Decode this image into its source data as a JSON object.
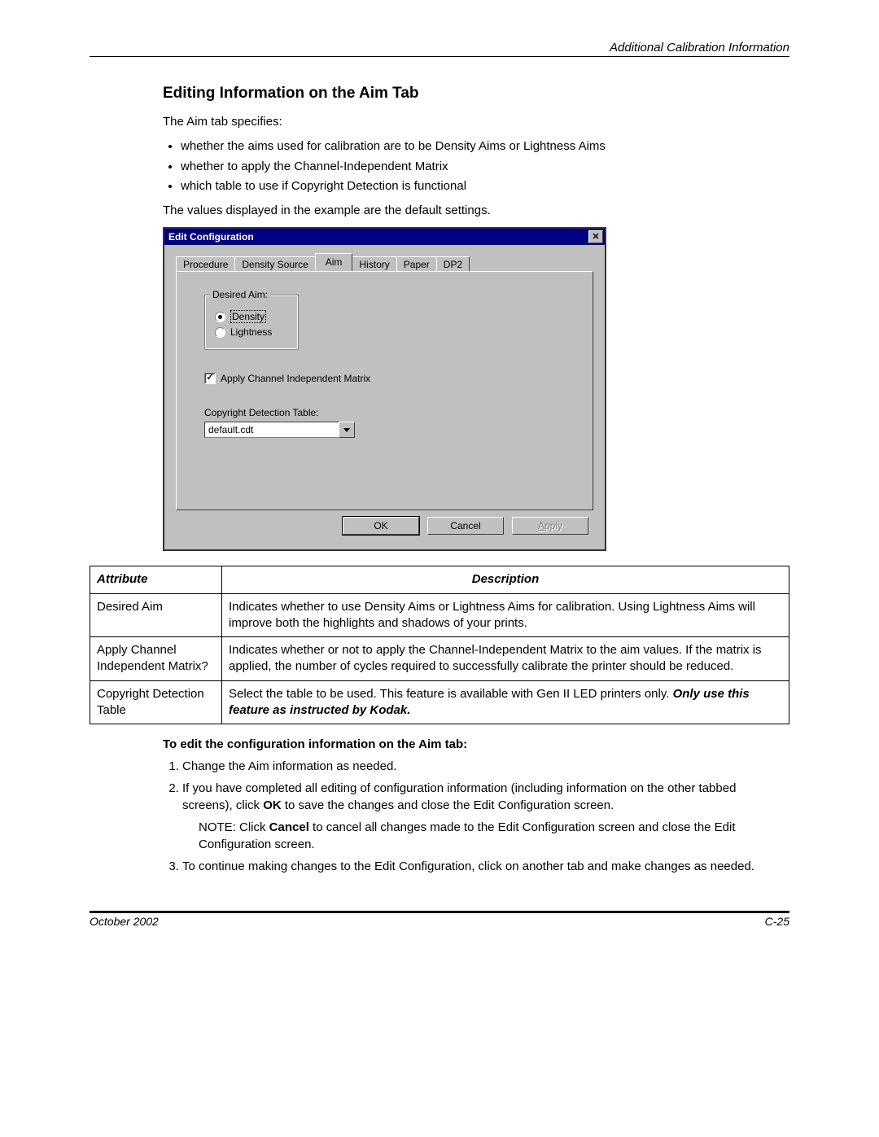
{
  "header": {
    "right": "Additional Calibration Information"
  },
  "section": {
    "title": "Editing Information on the Aim Tab",
    "intro": "The Aim tab specifies:",
    "bullets": [
      "whether the aims used for calibration are to be Density Aims or Lightness Aims",
      "whether to apply the Channel-Independent Matrix",
      "which table to use if Copyright Detection is functional"
    ],
    "defaults_note": "The values displayed in the example are the default settings."
  },
  "dialog": {
    "title": "Edit Configuration",
    "tabs": [
      "Procedure",
      "Density Source",
      "Aim",
      "History",
      "Paper",
      "DP2"
    ],
    "active_tab": "Aim",
    "group_label": "Desired Aim:",
    "radio_density": "Density",
    "radio_lightness": "Lightness",
    "checkbox_label": "Apply Channel Independent Matrix",
    "copyright_label": "Copyright Detection Table:",
    "copyright_value": "default.cdt",
    "ok": "OK",
    "cancel": "Cancel",
    "apply": "Apply"
  },
  "table": {
    "h1": "Attribute",
    "h2": "Description",
    "rows": [
      {
        "a": "Desired Aim",
        "d": "Indicates whether to use Density Aims or Lightness Aims for calibration. Using Lightness Aims will improve both the highlights and shadows of your prints."
      },
      {
        "a": "Apply Channel Independent Matrix?",
        "d": "Indicates whether or not to apply the Channel-Independent Matrix to the aim values. If the matrix is applied, the number of cycles required to successfully calibrate the printer should be reduced."
      },
      {
        "a": "Copyright Detection Table",
        "d_prefix": "Select the table to be used. This feature is available with Gen II LED printers only. ",
        "d_bold": "Only use this feature as instructed by Kodak."
      }
    ]
  },
  "procedure": {
    "heading": "To edit the configuration information on the Aim tab:",
    "steps": {
      "s1": "Change the Aim information as needed.",
      "s2_pre": "If you have completed all editing of configuration information (including information on the other tabbed screens), click ",
      "s2_bold": "OK",
      "s2_post": " to save the changes and close the Edit Configuration screen.",
      "note_pre": "NOTE:  Click ",
      "note_bold": "Cancel",
      "note_post": " to cancel all changes made to the Edit Configuration screen and close the Edit Configuration screen.",
      "s3": "To continue making changes to the Edit Configuration, click on another tab and make changes as needed."
    }
  },
  "footer": {
    "left": "October 2002",
    "right": "C-25"
  }
}
